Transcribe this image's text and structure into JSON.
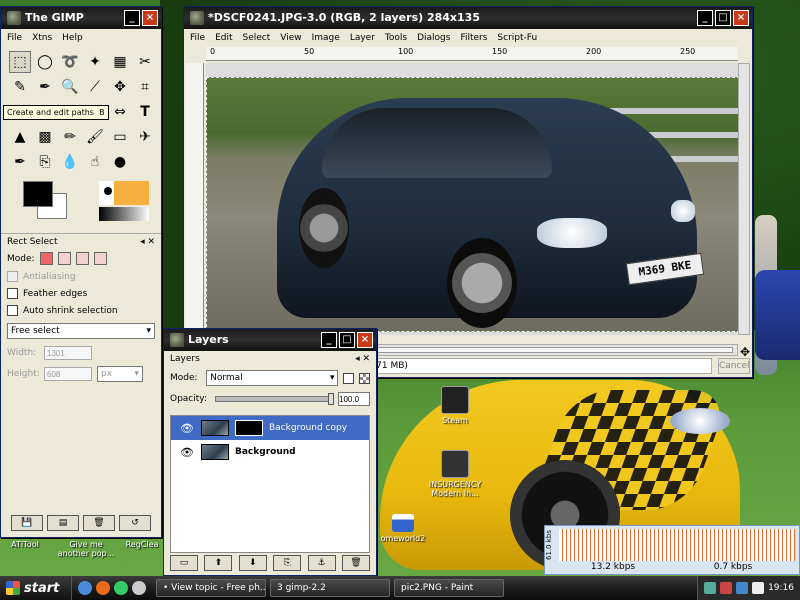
{
  "toolbox": {
    "title": "The GIMP",
    "menu": [
      "File",
      "Xtns",
      "Help"
    ],
    "tooltip": "Create and edit paths",
    "tooltip_key": "B",
    "options_title": "Rect Select",
    "mode_label": "Mode:",
    "antialiasing": "Antialiasing",
    "feather": "Feather edges",
    "auto_shrink": "Auto shrink selection",
    "select_value": "Free select",
    "width_label": "Width:",
    "width_value": "1301",
    "height_label": "Height:",
    "height_value": "608",
    "unit": "px"
  },
  "image_window": {
    "title": "*DSCF0241.JPG-3.0 (RGB, 2 layers) 284x135",
    "menu": [
      "File",
      "Edit",
      "Select",
      "View",
      "Image",
      "Layer",
      "Tools",
      "Dialogs",
      "Filters",
      "Script-Fu"
    ],
    "ruler": [
      "0",
      "50",
      "100",
      "150",
      "200",
      "250"
    ],
    "plate": "M369 BKE",
    "status": "mask (9.71 MB)",
    "cancel": "Cancel"
  },
  "layers": {
    "title": "Layers",
    "subtitle": "Layers",
    "mode_label": "Mode:",
    "mode_value": "Normal",
    "opacity_label": "Opacity:",
    "opacity_value": "100.0",
    "items": [
      {
        "name": "Background copy",
        "selected": true
      },
      {
        "name": "Background",
        "selected": false
      }
    ]
  },
  "desktop": {
    "icons": [
      {
        "label": "Steam"
      },
      {
        "label": "INSURGENCY Modern In..."
      },
      {
        "label": "ATITool"
      },
      {
        "label": "Give me another pop..."
      },
      {
        "label": "RegClea"
      },
      {
        "label": "omeworld2"
      }
    ]
  },
  "netmon": {
    "ylabel": "61.0 kbs",
    "down": "13.2 kbps",
    "up": "0.7 kbps"
  },
  "taskbar": {
    "start": "start",
    "tasks": [
      "• View topic - Free ph...",
      "3  gimp-2.2",
      "pic2.PNG - Paint"
    ],
    "clock": "19:16"
  }
}
